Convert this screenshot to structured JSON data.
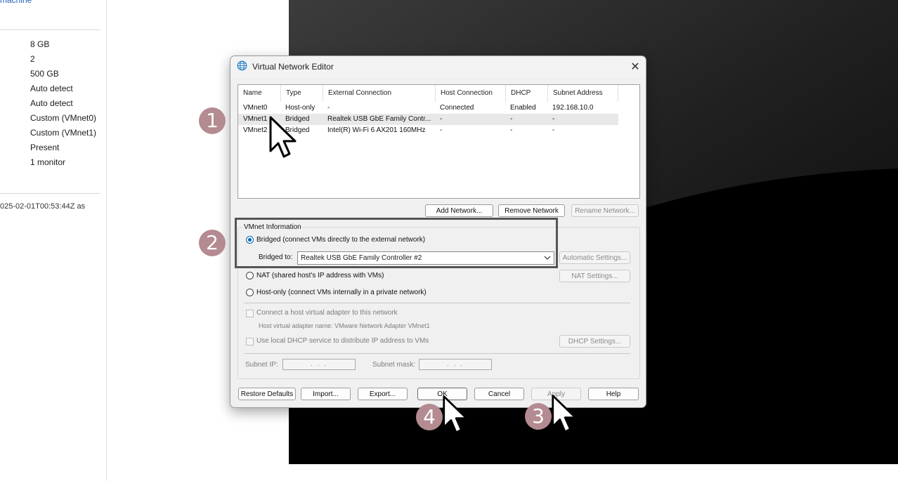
{
  "left_panel": {
    "top_link": "machine",
    "values": [
      "8 GB",
      "2",
      "500 GB",
      "Auto detect",
      "Auto detect",
      "Custom (VMnet0)",
      "Custom (VMnet1)",
      "Present",
      "1 monitor"
    ],
    "note": "025-02-01T00:53:44Z as"
  },
  "dialog": {
    "title": "Virtual Network Editor",
    "columns": [
      "Name",
      "Type",
      "External Connection",
      "Host Connection",
      "DHCP",
      "Subnet Address"
    ],
    "rows": [
      [
        "VMnet0",
        "Host-only",
        "-",
        "Connected",
        "Enabled",
        "192.168.10.0"
      ],
      [
        "VMnet1",
        "Bridged",
        "Realtek USB GbE Family Contr...",
        "-",
        "-",
        "-"
      ],
      [
        "VMnet2",
        "Bridged",
        "Intel(R) Wi-Fi 6 AX201 160MHz",
        "-",
        "-",
        "-"
      ]
    ],
    "selected_row": 1,
    "list_buttons": {
      "add": "Add Network...",
      "remove": "Remove Network",
      "rename": "Rename Network..."
    },
    "vmnet_info": {
      "label": "VMnet Information",
      "bridged_label": "Bridged (connect VMs directly to the external network)",
      "bridged_to_label": "Bridged to:",
      "bridged_to_value": "Realtek USB GbE Family Controller #2",
      "automatic_settings": "Automatic Settings...",
      "nat_label": "NAT (shared host's IP address with VMs)",
      "nat_settings": "NAT Settings...",
      "hostonly_label": "Host-only (connect VMs internally in a private network)",
      "connect_adapter_label": "Connect a host virtual adapter to this network",
      "adapter_name_label": "Host virtual adapter name: VMware Network Adapter VMnet1",
      "dhcp_label": "Use local DHCP service to distribute IP address to VMs",
      "dhcp_settings": "DHCP Settings...",
      "subnet_ip_label": "Subnet IP:",
      "subnet_mask_label": "Subnet mask:",
      "ip_placeholder": ". . .",
      "selected_mode": "bridged"
    },
    "footer_buttons": {
      "restore": "Restore Defaults",
      "import": "Import...",
      "export": "Export...",
      "ok": "OK",
      "cancel": "Cancel",
      "apply": "Apply",
      "help": "Help"
    }
  },
  "step_badges": [
    "1",
    "2",
    "3",
    "4"
  ],
  "colors": {
    "badge": "#b38b91",
    "accent": "#0063b1",
    "highlight_border": "#555555"
  },
  "icons": [
    "network-globe-icon",
    "close-icon",
    "chevron-down-icon",
    "mouse-cursor-icon"
  ]
}
